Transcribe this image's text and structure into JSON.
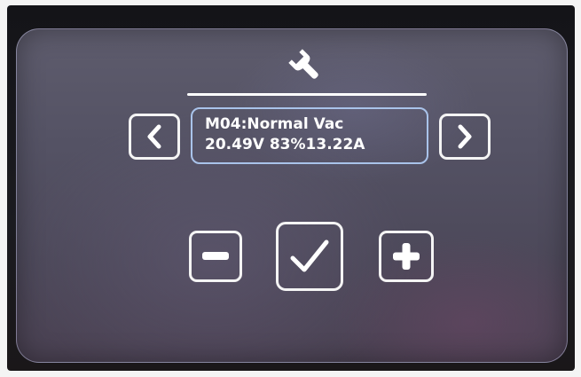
{
  "header": {
    "icon": "wrench-icon",
    "icon_color": "#ffffff"
  },
  "navigation": {
    "prev_icon": "chevron-left-icon",
    "next_icon": "chevron-right-icon"
  },
  "display": {
    "mode_line": "M04:Normal Vac",
    "reading_line": "20.49V 83%13.22A",
    "border_color": "#a9c3ea"
  },
  "controls": {
    "minus_icon": "minus-icon",
    "confirm_icon": "checkmark-icon",
    "plus_icon": "plus-icon"
  }
}
